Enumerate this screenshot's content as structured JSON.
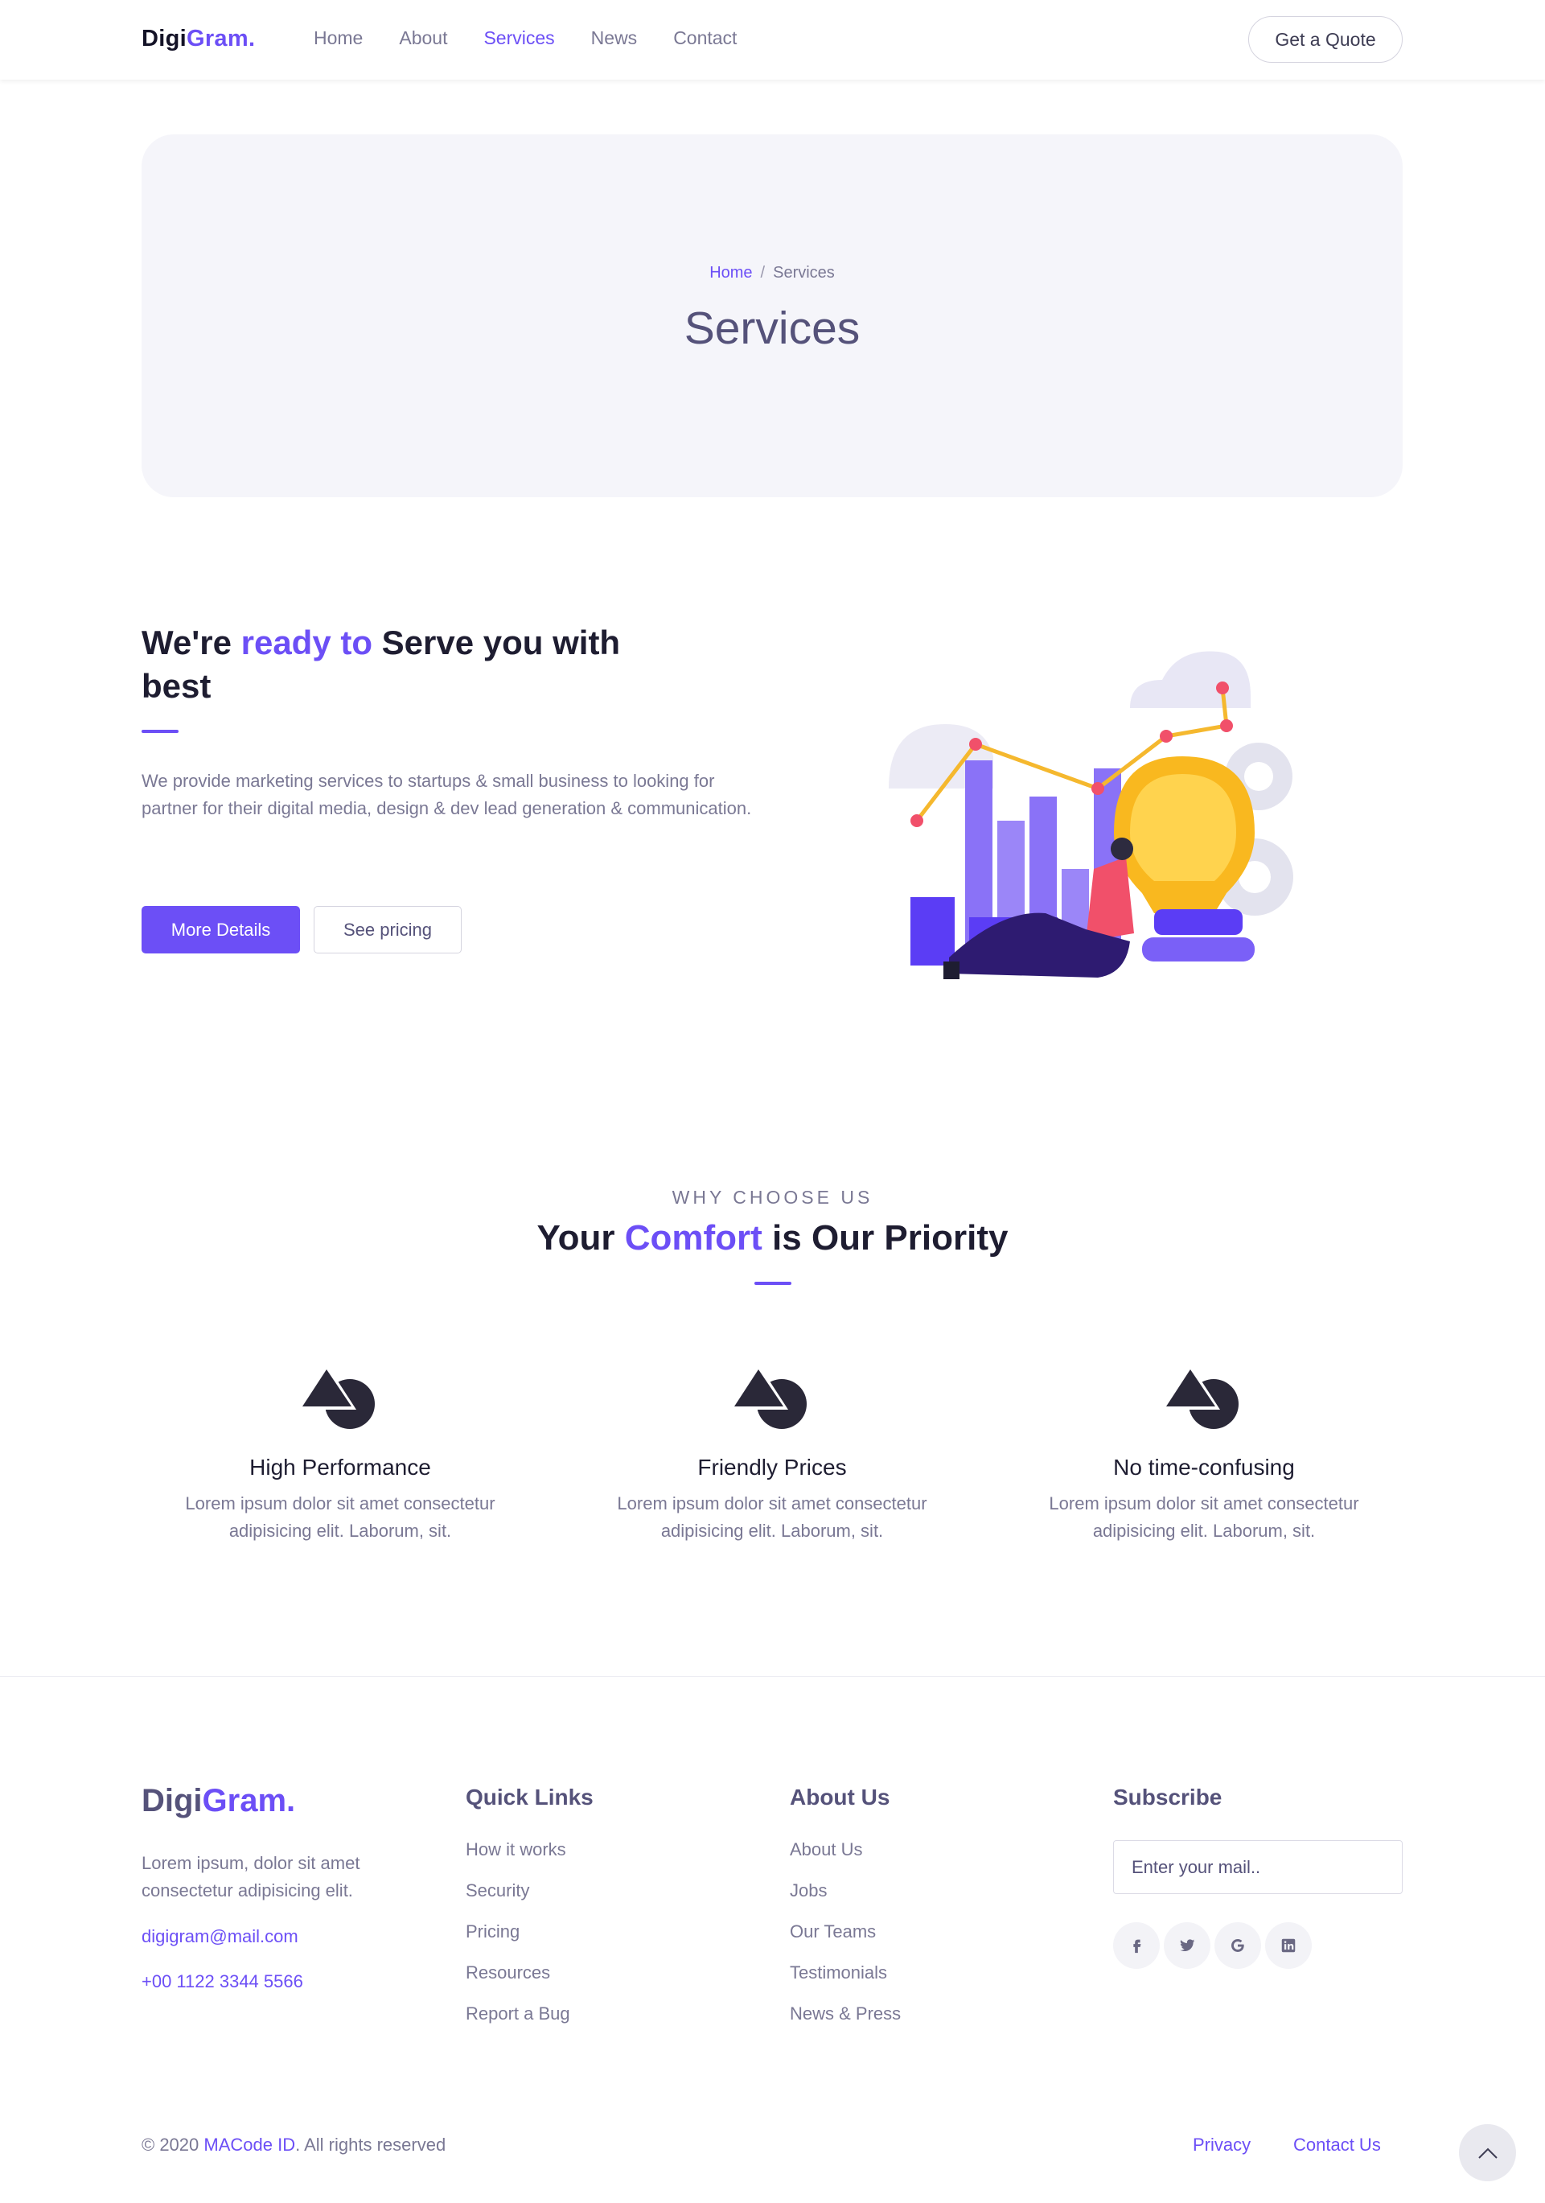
{
  "nav": {
    "logo_main": "Digi",
    "logo_accent": "Gram.",
    "links": [
      "Home",
      "About",
      "Services",
      "News",
      "Contact"
    ],
    "active_link": "Services",
    "quote_button": "Get a Quote"
  },
  "hero": {
    "breadcrumb_home": "Home",
    "breadcrumb_sep": "/",
    "breadcrumb_current": "Services",
    "title": "Services"
  },
  "intro": {
    "title_part1": "We're ",
    "title_accent": "ready to",
    "title_part2": " Serve you with best",
    "text": "We provide marketing services to startups & small business to looking for partner for their digital media, design & dev lead generation & communication.",
    "primary_button": "More Details",
    "secondary_button": "See pricing"
  },
  "why": {
    "eyebrow": "WHY CHOOSE US",
    "title_part1": "Your ",
    "title_accent": "Comfort",
    "title_part2": " is Our Priority",
    "features": [
      {
        "title": "High Performance",
        "text": "Lorem ipsum dolor sit amet consectetur adipisicing elit. Laborum, sit.",
        "icon": "shapes-icon"
      },
      {
        "title": "Friendly Prices",
        "text": "Lorem ipsum dolor sit amet consectetur adipisicing elit. Laborum, sit.",
        "icon": "shapes-icon"
      },
      {
        "title": "No time-confusing",
        "text": "Lorem ipsum dolor sit amet consectetur adipisicing elit. Laborum, sit.",
        "icon": "shapes-icon"
      }
    ]
  },
  "footer": {
    "logo_main": "Digi",
    "logo_accent": "Gram.",
    "about": "Lorem ipsum, dolor sit amet consectetur adipisicing elit.",
    "email": "digigram@mail.com",
    "phone": "+00 1122 3344 5566",
    "quick_links": {
      "heading": "Quick Links",
      "items": [
        "How it works",
        "Security",
        "Pricing",
        "Resources",
        "Report a Bug"
      ]
    },
    "about_us": {
      "heading": "About Us",
      "items": [
        "About Us",
        "Jobs",
        "Our Teams",
        "Testimonials",
        "News & Press"
      ]
    },
    "subscribe": {
      "heading": "Subscribe",
      "placeholder": "Enter your mail..",
      "socials": [
        "facebook-icon",
        "twitter-icon",
        "google-icon",
        "linkedin-icon"
      ]
    },
    "copyright_prefix": "© 2020 ",
    "copyright_brand": "MACode ID",
    "copyright_suffix": ". All rights reserved",
    "privacy": "Privacy",
    "contact": "Contact Us"
  },
  "colors": {
    "accent": "#6c4ff6",
    "heading": "#1e1d31",
    "muted": "#7a7894",
    "hero_bg": "#f5f5fa"
  }
}
